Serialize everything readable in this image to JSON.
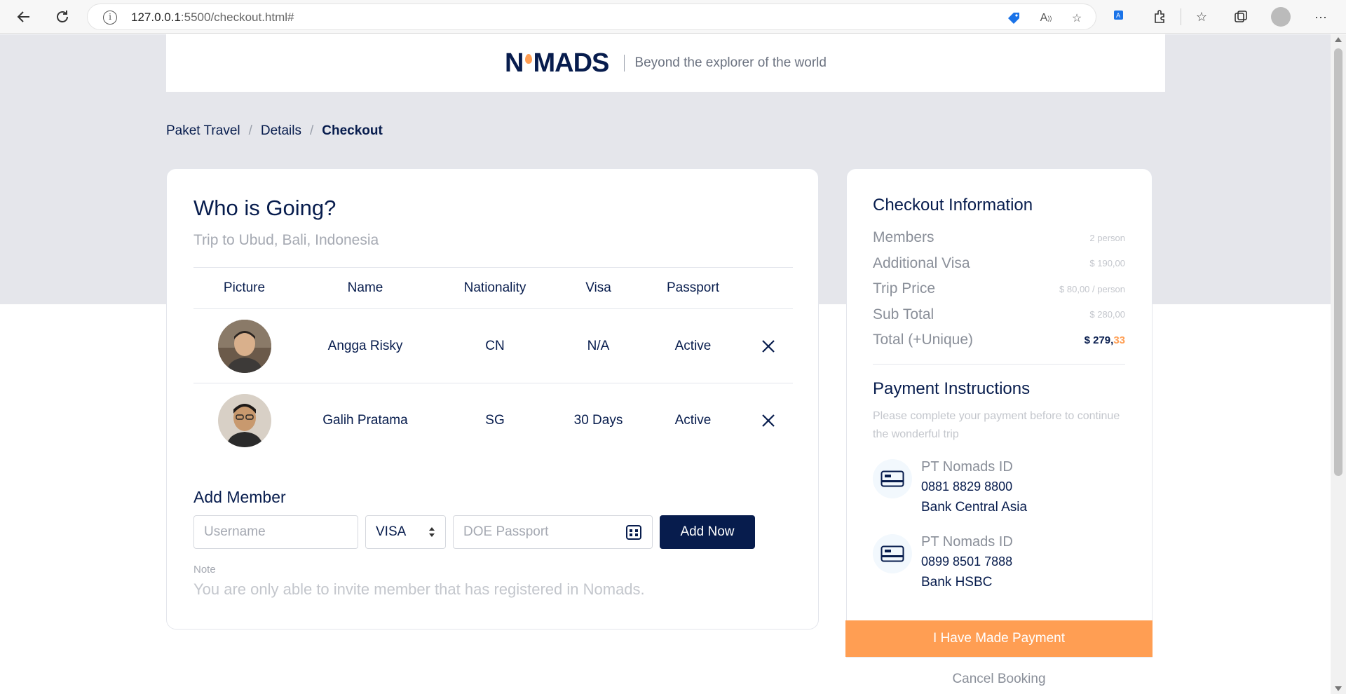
{
  "browser": {
    "url_host": "127.0.0.1",
    "url_path": ":5500/checkout.html#"
  },
  "header": {
    "logo_pre": "N",
    "logo_post": "MADS",
    "tagline": "Beyond the explorer of the world"
  },
  "breadcrumb": {
    "items": [
      "Paket Travel",
      "Details",
      "Checkout"
    ],
    "separator": "/"
  },
  "main": {
    "title": "Who is Going?",
    "subtitle": "Trip to Ubud, Bali, Indonesia",
    "columns": [
      "Picture",
      "Name",
      "Nationality",
      "Visa",
      "Passport"
    ],
    "members": [
      {
        "name": "Angga Risky",
        "nationality": "CN",
        "visa": "N/A",
        "passport": "Active"
      },
      {
        "name": "Galih Pratama",
        "nationality": "SG",
        "visa": "30 Days",
        "passport": "Active"
      }
    ],
    "add_member": {
      "title": "Add Member",
      "username_placeholder": "Username",
      "visa_value": "VISA",
      "doe_placeholder": "DOE Passport",
      "button": "Add Now"
    },
    "note_label": "Note",
    "note_text": "You are only able to invite member that has registered in Nomads."
  },
  "sidebar": {
    "checkout_title": "Checkout Information",
    "rows": [
      {
        "label": "Members",
        "value": "2 person"
      },
      {
        "label": "Additional Visa",
        "value": "$ 190,00"
      },
      {
        "label": "Trip Price",
        "value": "$ 80,00 / person"
      },
      {
        "label": "Sub Total",
        "value": "$ 280,00"
      }
    ],
    "total_label": "Total (+Unique)",
    "total_main": "$ 279,",
    "total_unique": "33",
    "payment_title": "Payment Instructions",
    "payment_desc": "Please complete your payment before to continue the wonderful trip",
    "banks": [
      {
        "name": "PT Nomads ID",
        "number": "0881 8829 8800",
        "bank": "Bank Central Asia"
      },
      {
        "name": "PT Nomads ID",
        "number": "0899 8501 7888",
        "bank": "Bank HSBC"
      }
    ],
    "paid_button": "I Have Made Payment",
    "cancel": "Cancel Booking"
  },
  "colors": {
    "navy": "#071C4D",
    "orange": "#FF9E53",
    "band": "#E5E6EB"
  }
}
